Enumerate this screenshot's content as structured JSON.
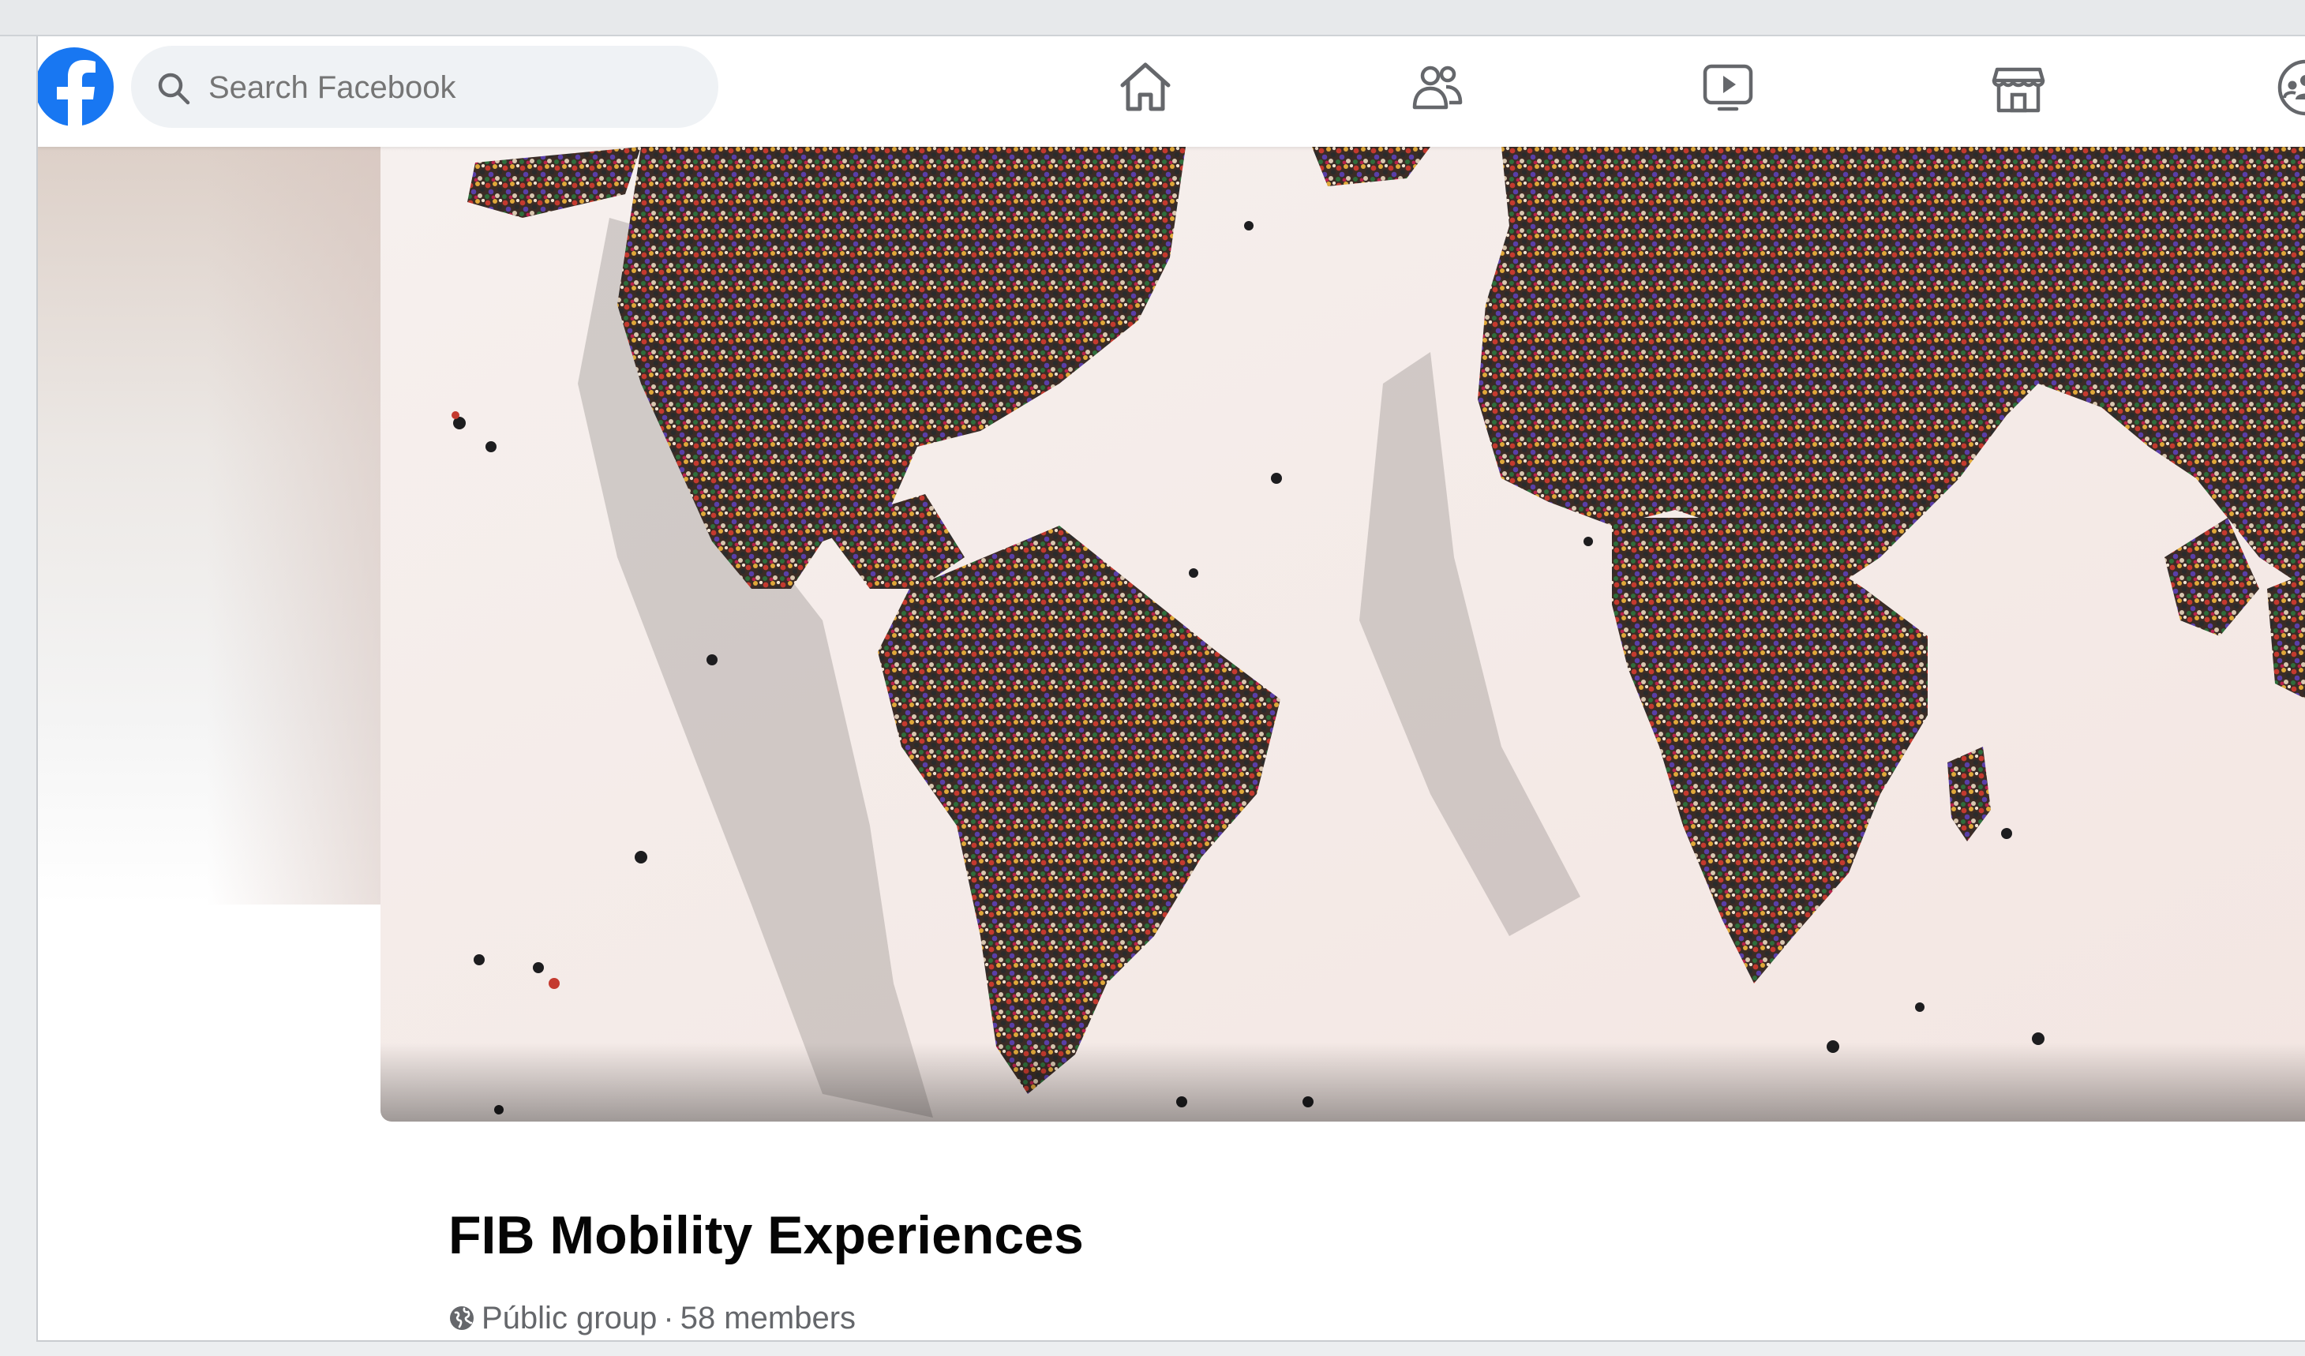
{
  "search": {
    "placeholder": "Search Facebook"
  },
  "nav": [
    {
      "name": "home",
      "icon": "home-icon"
    },
    {
      "name": "friends",
      "icon": "friends-icon"
    },
    {
      "name": "watch",
      "icon": "video-play-icon"
    },
    {
      "name": "marketplace",
      "icon": "marketplace-store-icon"
    },
    {
      "name": "groups",
      "icon": "groups-icon"
    }
  ],
  "group": {
    "title": "FIB Mobility Experiences",
    "privacy": "Públic group",
    "separator": "·",
    "members": "58 members"
  },
  "colors": {
    "brand": "#1877f2",
    "icon": "#65676b",
    "title": "#050505"
  }
}
